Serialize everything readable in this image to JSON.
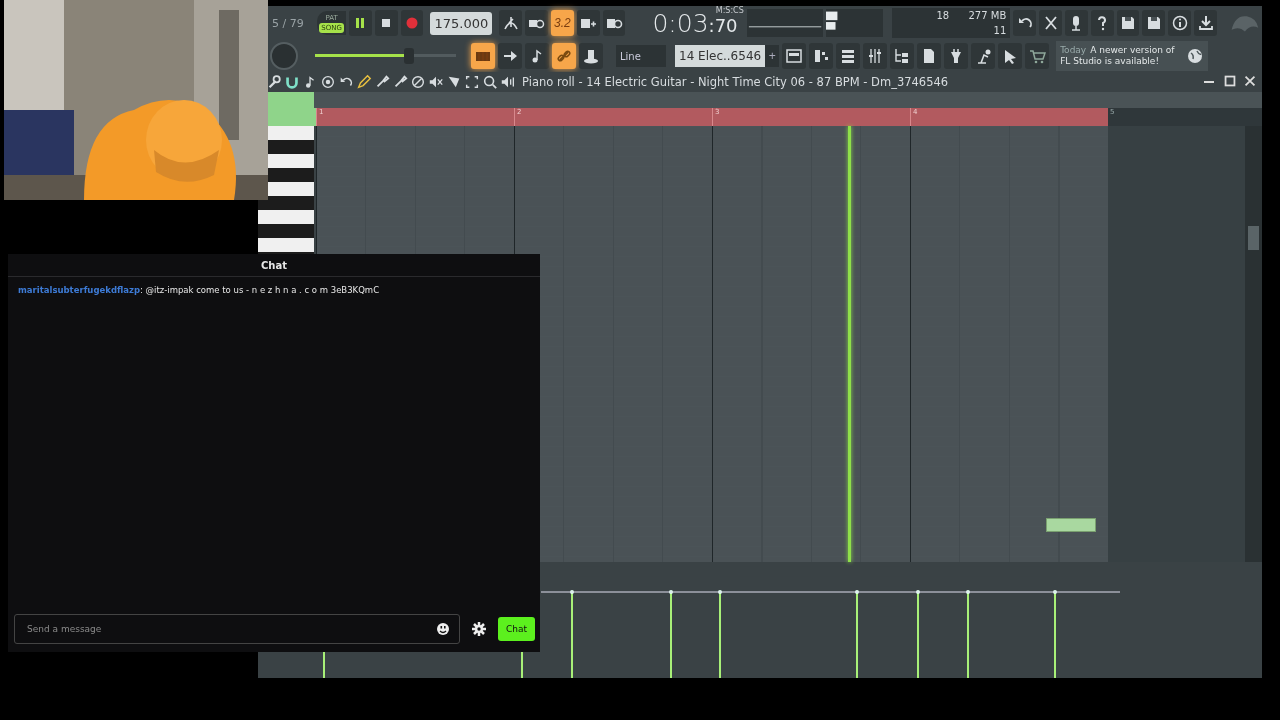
{
  "transport": {
    "pattern_count": "5 / 79",
    "modes": [
      {
        "label": "PAT",
        "selected": false
      },
      {
        "label": "SONG",
        "selected": true
      }
    ],
    "tempo": "175.000",
    "time_main": "0:03",
    "time_sub": ":70",
    "time_format": "M:S:CS"
  },
  "record_buttons": [
    {
      "kind": "metronome",
      "on": false
    },
    {
      "kind": "wait",
      "on": false
    },
    {
      "kind": "step",
      "on": true,
      "label": "3.2"
    },
    {
      "kind": "keys-plus",
      "on": false
    },
    {
      "kind": "loop",
      "on": false
    }
  ],
  "meters": {
    "polyphony": "18",
    "memory": "277 MB",
    "cpu": "11"
  },
  "master_volume": {
    "level": 0.67
  },
  "tool_buttons": [
    {
      "kind": "typing-keyboard",
      "on": true
    },
    {
      "kind": "arrow",
      "on": false
    },
    {
      "kind": "note",
      "on": false
    },
    {
      "kind": "link",
      "on": true
    },
    {
      "kind": "hat",
      "on": false
    }
  ],
  "snap": {
    "value": "Line"
  },
  "channel": {
    "name": "14 Elec..6546",
    "add": "+"
  },
  "hint": {
    "when": "Today",
    "lines": [
      "A newer version of",
      "FL Studio is available!"
    ]
  },
  "piano_roll": {
    "title": "Piano roll - 14 Electric Guitar - Night Time City 06 - 87 BPM - Dm_3746546",
    "bars": [
      "1",
      "2",
      "3",
      "4",
      "5"
    ]
  },
  "chat": {
    "title": "Chat",
    "messages": [
      {
        "user": "maritalsubterfugekdflazp",
        "text": ": @itz-impak come to us - n e z h n a . c o m 3eB3KQmC"
      }
    ],
    "placeholder": "Send a message",
    "send": "Chat"
  }
}
